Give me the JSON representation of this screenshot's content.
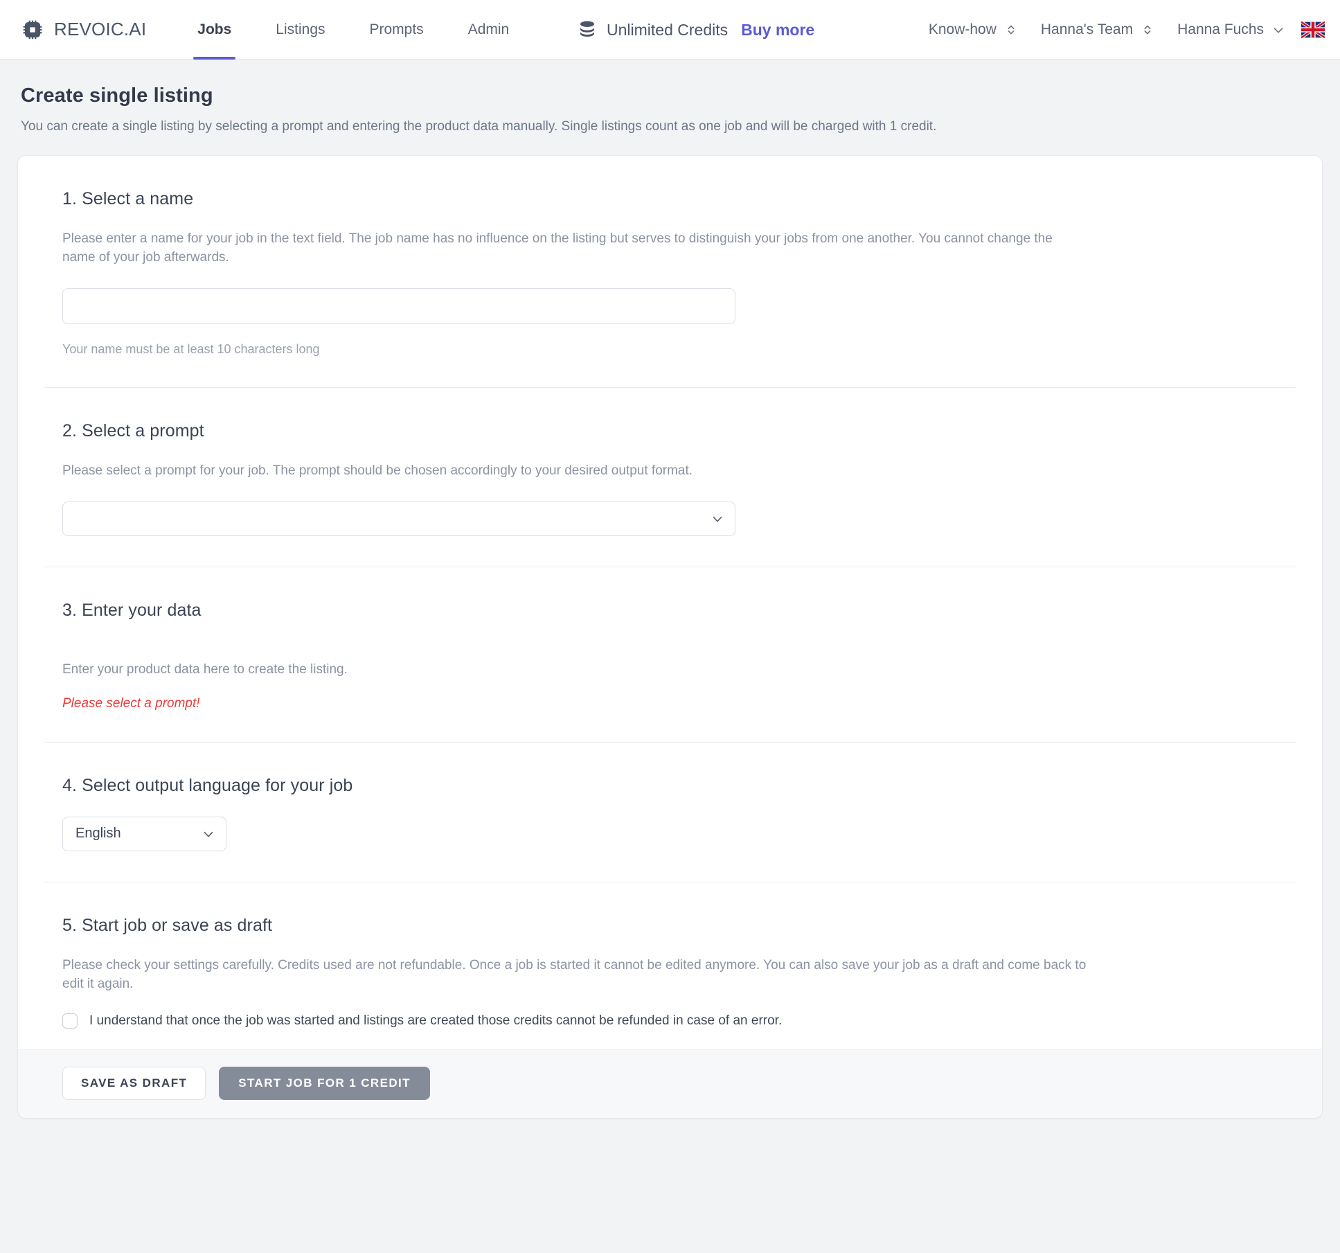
{
  "header": {
    "brand": {
      "name": "REVOIC.AI",
      "icon": "chip-icon"
    },
    "tabs": [
      {
        "label": "Jobs",
        "active": true
      },
      {
        "label": "Listings",
        "active": false
      },
      {
        "label": "Prompts",
        "active": false
      },
      {
        "label": "Admin",
        "active": false
      }
    ],
    "credits": {
      "icon": "coins-stack-icon",
      "label": "Unlimited Credits",
      "buy_label": "Buy more",
      "buy_color": "#5b5bd6"
    },
    "right": {
      "knowhow": "Know-how",
      "team": "Hanna's Team",
      "user": "Hanna Fuchs",
      "flag": "uk-flag-icon"
    }
  },
  "page": {
    "title": "Create single listing",
    "subtitle": "You can create a single listing by selecting a prompt and entering the product data manually. Single listings count as one job and will be charged with 1 credit."
  },
  "sections": {
    "name": {
      "title": "1. Select a name",
      "description": "Please enter a name for your job in the text field. The job name has no influence on the listing but serves to distinguish your jobs from one another. You cannot change the name of your job afterwards.",
      "value": "",
      "placeholder": "",
      "hint": "Your name must be at least 10 characters long"
    },
    "prompt": {
      "title": "2. Select a prompt",
      "description": "Please select a prompt for your job. The prompt should be chosen accordingly to your desired output format.",
      "selected": ""
    },
    "data": {
      "title": "3. Enter your data",
      "description": "Enter your product data here to create the listing.",
      "error": "Please select a prompt!",
      "error_color": "#ef3a3a"
    },
    "language": {
      "title": "4. Select output language for your job",
      "selected": "English"
    },
    "start": {
      "title": "5. Start job or save as draft",
      "description": "Please check your settings carefully. Credits used are not refundable. Once a job is started it cannot be edited anymore. You can also save your job as a draft and come back to edit it again.",
      "consent_label": "I understand that once the job was started and listings are created those credits cannot be refunded in case of an error.",
      "consent_checked": false
    }
  },
  "footer": {
    "save_draft_label": "SAVE AS DRAFT",
    "start_job_label": "START JOB FOR 1 CREDIT"
  }
}
